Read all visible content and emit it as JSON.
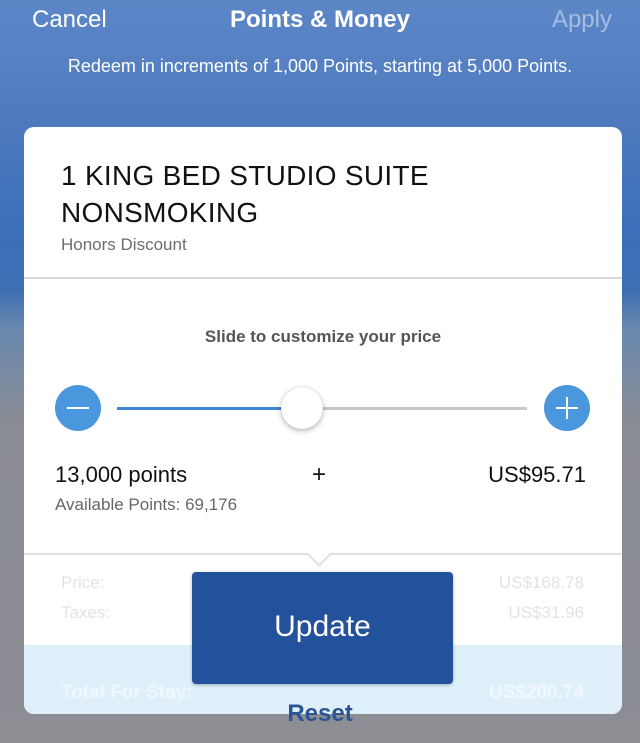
{
  "nav": {
    "cancel_label": "Cancel",
    "title": "Points & Money",
    "apply_label": "Apply"
  },
  "subtitle": "Redeem in increments of 1,000 Points, starting at 5,000 Points.",
  "room": {
    "title": "1 KING BED STUDIO SUITE NONSMOKING",
    "rate_name": "Honors Discount"
  },
  "slider": {
    "hint": "Slide to customize your price",
    "position_fraction": 0.45,
    "minus_icon": "minus-icon",
    "plus_icon": "plus-icon"
  },
  "selection": {
    "points": "13,000 points",
    "separator": "+",
    "money": "US$95.71",
    "available_points": "Available Points: 69,176"
  },
  "summary": {
    "price_label": "Price:",
    "price_value": "US$168.78",
    "taxes_label": "Taxes:",
    "taxes_value": "US$31.96",
    "total_label": "Total For Stay:",
    "total_value": "US$200.74"
  },
  "actions": {
    "update_label": "Update",
    "reset_label": "Reset"
  },
  "colors": {
    "accent": "#4a97dd",
    "primary_button": "#24519c",
    "total_band": "#dff0fb"
  }
}
